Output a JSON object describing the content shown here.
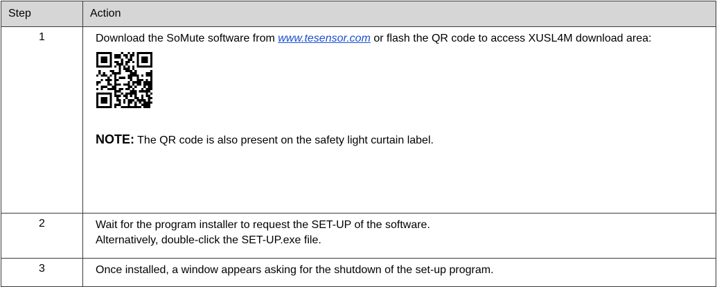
{
  "table": {
    "headers": {
      "step": "Step",
      "action": "Action"
    },
    "row1": {
      "step": "1",
      "text_before_link": "Download the SoMute software from ",
      "link_text": "www.tesensor.com",
      "text_after_link": " or flash the QR code to access XUSL4M download area:",
      "note_label": "NOTE:",
      "note_text": " The QR code is also present on the safety light curtain label."
    },
    "row2": {
      "step": "2",
      "line1": "Wait for the program installer to request the SET-UP of the software.",
      "line2": "Alternatively, double-click the SET-UP.exe file."
    },
    "row3": {
      "step": "3",
      "text": "Once installed, a window appears asking for the shutdown of the set-up program."
    }
  },
  "colors": {
    "header_bg": "#d6d6d6",
    "link": "#1a4fd1",
    "border": "#3a3a3a"
  }
}
